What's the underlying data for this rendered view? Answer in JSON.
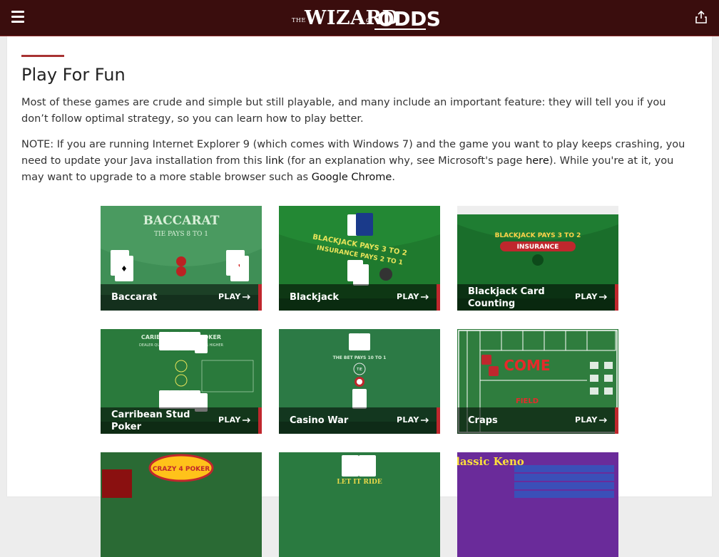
{
  "header": {
    "logo": {
      "the": "THE",
      "wizard": "WIZARD",
      "of": "of",
      "odds": "ODDS"
    },
    "icons": {
      "menu": "hamburger-menu-icon",
      "share": "share-icon"
    },
    "colors": {
      "bar": "#3a0d0d",
      "accent": "#c0272d"
    }
  },
  "page": {
    "title": "Play For Fun",
    "intro": "Most of these games are crude and simple but still playable, and many include an important feature: they will tell you if you don’t follow optimal strategy, so you can learn how to play better.",
    "note": {
      "part1": "NOTE: If you are running Internet Explorer 9 (which comes with Windows 7) and the game you want to play keeps crashing, you need to update your Java installation from this ",
      "link1": "link",
      "part2": " (for an explanation why, see Microsoft's page ",
      "link2": "here",
      "part3": "). While you're at it, you may want to upgrade to a more stable browser such as ",
      "link3": "Google Chrome",
      "part4": "."
    }
  },
  "games": [
    {
      "name": "Baccarat",
      "play": "PLAY",
      "art_text": "BACCARAT",
      "art_sub": "TIE PAYS 8 TO 1",
      "theme": "#3c8a54"
    },
    {
      "name": "Blackjack",
      "play": "PLAY",
      "art_text": "BLACKJACK PAYS 3 TO 2",
      "art_sub": "INSURANCE PAYS 2 TO 1",
      "theme": "#1f7a2e"
    },
    {
      "name": "Blackjack Card Counting",
      "play": "PLAY",
      "art_text": "BLACKJACK PAYS 3 TO 2",
      "art_sub": "INSURANCE",
      "theme": "#1a6e2b"
    },
    {
      "name": "Carribean Stud Poker",
      "play": "PLAY",
      "art_text": "CARIBBEAN STUD POKER",
      "art_sub": "DEALER QUALIFIES WITH ACE-KING OR HIGHER",
      "theme": "#2a7a3c"
    },
    {
      "name": "Casino War",
      "play": "PLAY",
      "art_text": "THE BET PAYS 10 TO 1",
      "art_sub": "TIE",
      "theme": "#2c7a45"
    },
    {
      "name": "Craps",
      "play": "PLAY",
      "art_text": "COME",
      "art_sub": "FIELD",
      "theme": "#2f7d3e"
    },
    {
      "name": "",
      "play": "",
      "art_text": "CRAZY 4 POKER",
      "art_sub": "",
      "theme": "#2a6a34"
    },
    {
      "name": "",
      "play": "",
      "art_text": "LET IT RIDE",
      "art_sub": "",
      "theme": "#2a7a40"
    },
    {
      "name": "",
      "play": "",
      "art_text": "Classic Keno",
      "art_sub": "",
      "theme": "#6a2b9a"
    }
  ]
}
